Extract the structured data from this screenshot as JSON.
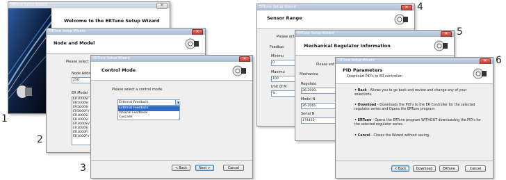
{
  "callouts": [
    "1",
    "2",
    "3",
    "4",
    "5",
    "6"
  ],
  "win1": {
    "title": "ERTune Setup Wizard",
    "heading": "Welcome to the ERTune Setup Wizard"
  },
  "win2": {
    "title": "ERTune Setup Wizard",
    "heading": "Node and Model",
    "prompt": "Please select",
    "node_label": "Node Addre",
    "node_value": "250",
    "model_label": "ER Model",
    "models": [
      "ER3000SI",
      "ER5000SI",
      "ER5000SI",
      "ER5000FV",
      "ER3000SI",
      "ER3000SI",
      "ER3000SV",
      "ER3000SI",
      "ER3000FI",
      "ER3000FV"
    ]
  },
  "win3": {
    "title": "ERTune Setup Wizard",
    "heading": "Control Mode",
    "prompt": "Please select a control mode.",
    "selected": "External Feedback",
    "options": [
      "External Feedback",
      "Internal Feedback",
      "Cascade"
    ],
    "back": "< Back",
    "next": "Next >",
    "cancel": "Cancel"
  },
  "win4": {
    "title": "ERTune Setup Wizard",
    "heading": "Sensor Range",
    "prompt": "Please ent",
    "feedback_label": "Feedbac",
    "min_label": "Minimu",
    "min_value": "0",
    "max_label": "Maximu",
    "max_value": "100",
    "unit_label": "Unit of M",
    "unit_value": "%"
  },
  "win5": {
    "title": "ERTune Setup Wizard",
    "heading": "Mechanical Regulator Information",
    "prompt": "Please ent",
    "mech_label": "Mechanica",
    "reg_label": "Regulato",
    "reg_value": "26-2000",
    "model_label": "Model N",
    "model_value": "26-2065",
    "serial_label": "Serial N",
    "serial_value": "174435-"
  },
  "win6": {
    "title": "ERTune Setup Wizard",
    "heading": "PID Parameters",
    "subheading": "Download PID's to ER controller.",
    "bullets": [
      {
        "key": "• Back",
        "text": " - Allows you to go back and review and change any of your selections."
      },
      {
        "key": "• Download",
        "text": " - Downloads the PID's to the ER Controller for the selected regulator series and Opens the ERTune program."
      },
      {
        "key": "• ERTune",
        "text": " - Opens the ERTune program WITHOUT downloading the PID's for the selected regulator series."
      },
      {
        "key": "• Cancel",
        "text": " - Closes the Wizard without saving."
      }
    ],
    "back": "< Back",
    "download": "Download",
    "ertune": "ERTune",
    "cancel": "Cancel"
  }
}
